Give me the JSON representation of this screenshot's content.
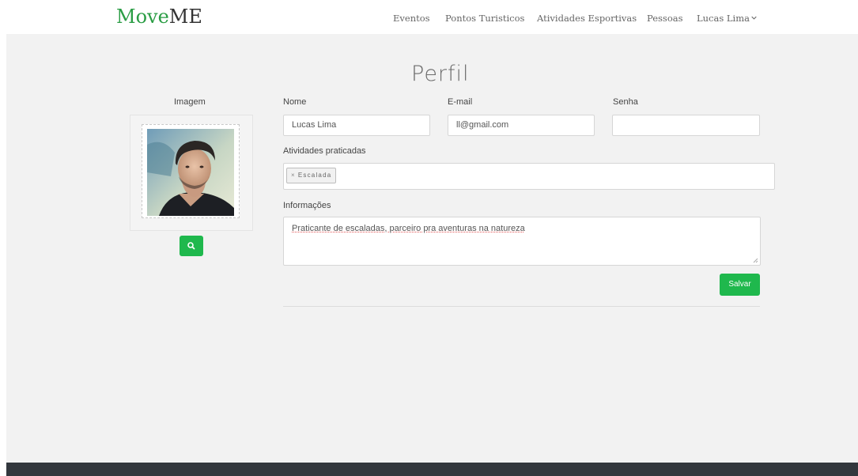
{
  "brand": {
    "part1": "Move",
    "part2": "ME"
  },
  "nav": {
    "items": [
      "Eventos",
      "Pontos Turisticos",
      "Atividades Esportivas",
      "Pessoas"
    ],
    "user": "Lucas Lima"
  },
  "page": {
    "title": "Perfil"
  },
  "image_section": {
    "label": "Imagem",
    "search_icon": "search-icon"
  },
  "form": {
    "name_label": "Nome",
    "name_value": "Lucas Lima",
    "email_label": "E-mail",
    "email_value": "ll@gmail.com",
    "password_label": "Senha",
    "password_value": "",
    "activities_label": "Atividades praticadas",
    "activities": [
      {
        "label": "Escalada"
      }
    ],
    "info_label": "Informações",
    "info_value": "Praticante de escaladas, parceiro pra aventuras na natureza",
    "save_label": "Salvar"
  },
  "colors": {
    "accent": "#1fb84d",
    "brand_green": "#2a9d44",
    "footer": "#32373d",
    "background": "#f2f2f2"
  }
}
